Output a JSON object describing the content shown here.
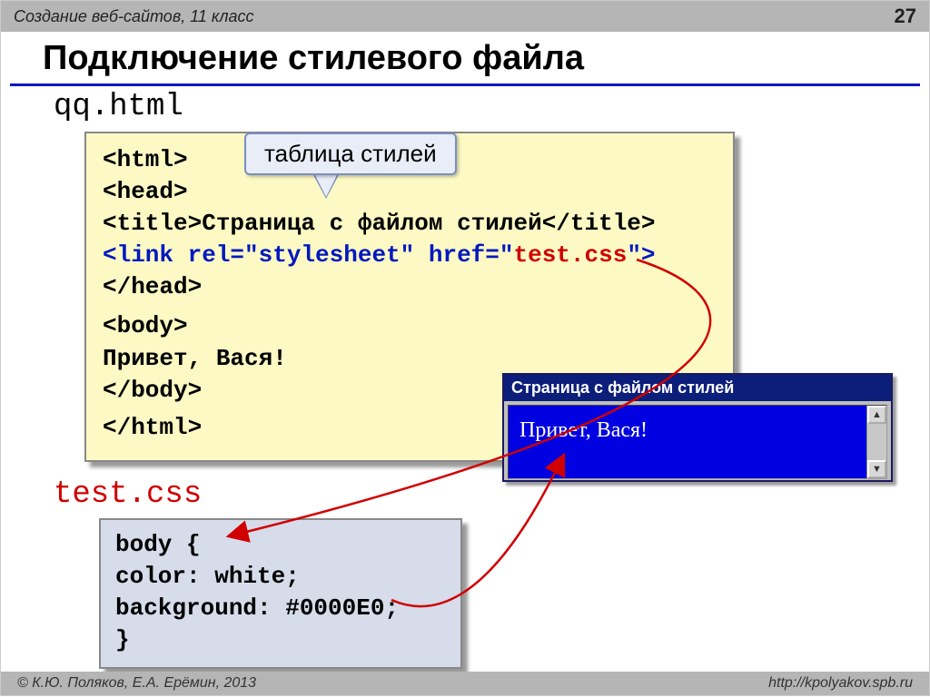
{
  "topbar": {
    "course": "Создание веб-сайтов, 11 класс",
    "pagenum": "27"
  },
  "title": "Подключение стилевого файла",
  "file1_name": "qq.html",
  "code1": {
    "l1": "<html>",
    "l2": "<head>",
    "l3a": "<title>",
    "l3b": "Страница с файлом стилей",
    "l3c": "</title>",
    "l4a": "<link rel=\"stylesheet\" href=\"",
    "l4b": "test.css",
    "l4c": "\">",
    "l5": "</head>",
    "l6": "<body>",
    "l7": "Привет, Вася!",
    "l8": "</body>",
    "l9": "</html>"
  },
  "callout_label": "таблица стилей",
  "file2_name": "test.css",
  "code2": {
    "l1": "body {",
    "l2": "  color: white;",
    "l3": "  background: #0000E0;",
    "l4": "}"
  },
  "browser": {
    "title": "Страница с файлом стилей",
    "body": "Привет, Вася!",
    "up": "▲",
    "down": "▼"
  },
  "footer": {
    "copyright": "© К.Ю. Поляков, Е.А. Ерёмин, 2013",
    "url": "http://kpolyakov.spb.ru"
  }
}
